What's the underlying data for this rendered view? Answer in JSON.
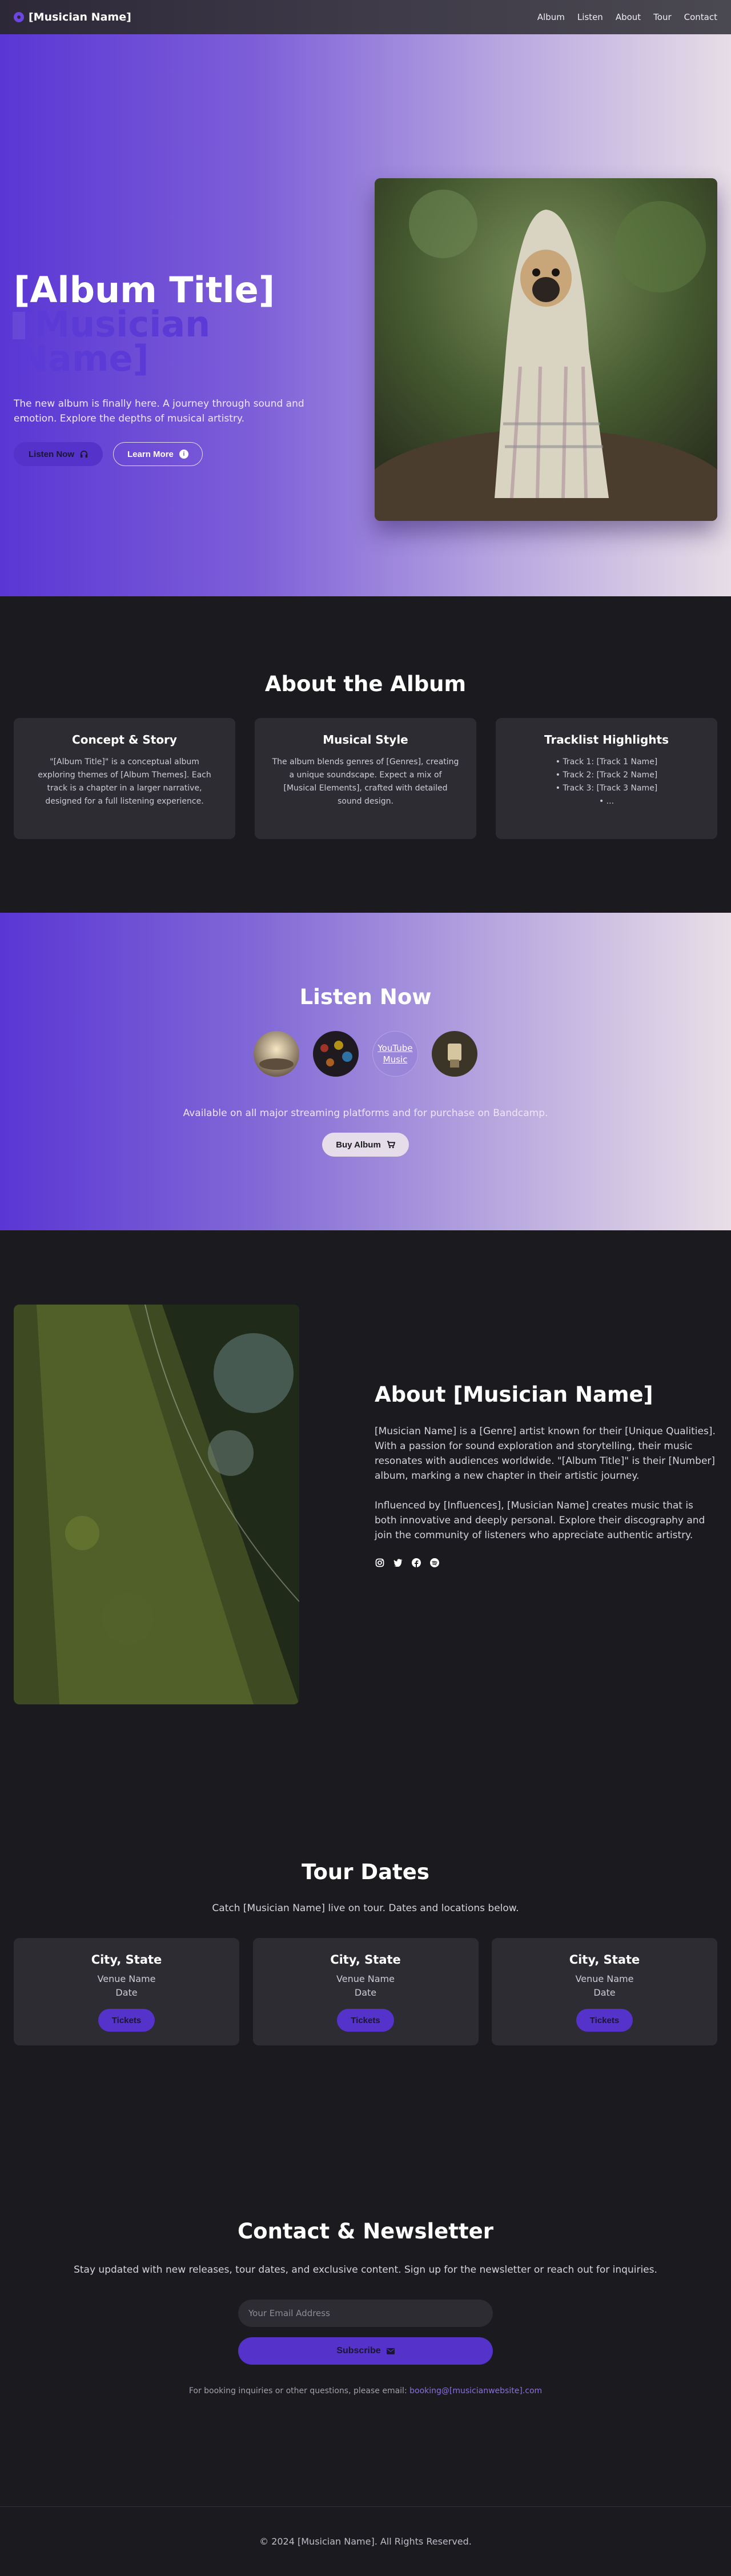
{
  "nav": {
    "brand": "[Musician Name]",
    "links": [
      "Album",
      "Listen",
      "About",
      "Tour",
      "Contact"
    ]
  },
  "hero": {
    "title": "[Album Title]",
    "subtitle": "[Musician Name]",
    "description": "The new album is finally here. A journey through sound and emotion. Explore the depths of musical artistry.",
    "listen_label": "Listen Now",
    "learn_label": "Learn More"
  },
  "album": {
    "title": "About the Album",
    "cards": [
      {
        "title": "Concept & Story",
        "body": "\"[Album Title]\" is a conceptual album exploring themes of [Album Themes]. Each track is a chapter in a larger narrative, designed for a full listening experience."
      },
      {
        "title": "Musical Style",
        "body": "The album blends genres of [Genres], creating a unique soundscape. Expect a mix of [Musical Elements], crafted with detailed sound design."
      },
      {
        "title": "Tracklist Highlights",
        "tracks": [
          "Track 1: [Track 1 Name]",
          "Track 2: [Track 2 Name]",
          "Track 3: [Track 3 Name]",
          "..."
        ]
      }
    ]
  },
  "listen": {
    "title": "Listen Now",
    "youtube_label": "YouTube Music",
    "availability": "Available on all major streaming platforms and for purchase on Bandcamp.",
    "buy_label": "Buy Album"
  },
  "about": {
    "title": "About [Musician Name]",
    "p1": "[Musician Name] is a [Genre] artist known for their [Unique Qualities]. With a passion for sound exploration and storytelling, their music resonates with audiences worldwide. \"[Album Title]\" is their [Number] album, marking a new chapter in their artistic journey.",
    "p2": "Influenced by [Influences], [Musician Name] creates music that is both innovative and deeply personal. Explore their discography and join the community of listeners who appreciate authentic artistry."
  },
  "tour": {
    "title": "Tour Dates",
    "subtitle": "Catch [Musician Name] live on tour. Dates and locations below.",
    "dates": [
      {
        "city": "City, State",
        "venue": "Venue Name",
        "date": "Date",
        "button": "Tickets"
      },
      {
        "city": "City, State",
        "venue": "Venue Name",
        "date": "Date",
        "button": "Tickets"
      },
      {
        "city": "City, State",
        "venue": "Venue Name",
        "date": "Date",
        "button": "Tickets"
      }
    ]
  },
  "contact": {
    "title": "Contact & Newsletter",
    "subtitle": "Stay updated with new releases, tour dates, and exclusive content. Sign up for the newsletter or reach out for inquiries.",
    "email_placeholder": "Your Email Address",
    "subscribe_label": "Subscribe",
    "booking_prefix": "For booking inquiries or other questions, please email:",
    "booking_email": "booking@[musicianwebsite].com"
  },
  "footer": {
    "text": "© 2024 [Musician Name]. All Rights Reserved."
  },
  "colors": {
    "accent": "#5532c9",
    "background": "#1b1b1f",
    "card": "#2e2c33"
  }
}
